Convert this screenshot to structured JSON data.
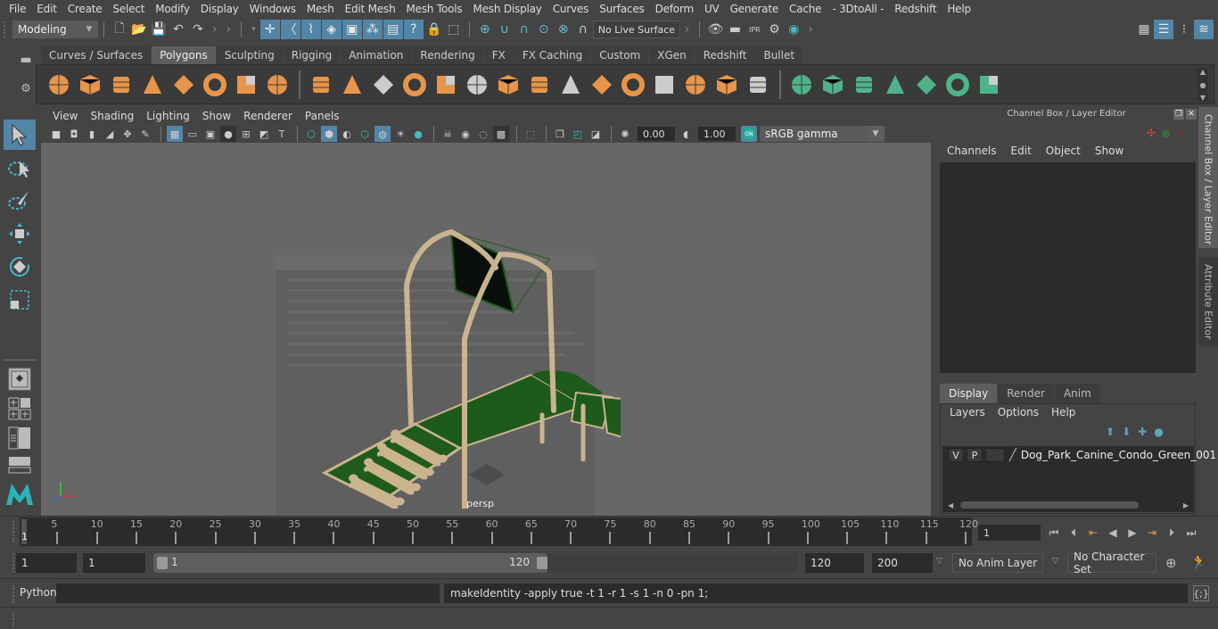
{
  "menubar": [
    "File",
    "Edit",
    "Create",
    "Select",
    "Modify",
    "Display",
    "Windows",
    "Mesh",
    "Edit Mesh",
    "Mesh Tools",
    "Mesh Display",
    "Curves",
    "Surfaces",
    "Deform",
    "UV",
    "Generate",
    "Cache",
    "- 3DtoAll -",
    "Redshift",
    "Help"
  ],
  "statusline": {
    "mode": "Modeling",
    "live_surface": "No Live Surface",
    "file_icons": [
      "new-scene-icon",
      "open-scene-icon",
      "save-scene-icon",
      "undo-icon",
      "redo-icon"
    ],
    "select_mode_icons": [
      "select-hierarchy-icon",
      "select-objects-icon",
      "select-components-icon",
      "select-by-component-type-icon",
      "select-surface-icon",
      "select-lattice-icon",
      "select-render-icon",
      "select-misc-icon"
    ],
    "snap_icons": [
      "snap-grid-icon",
      "snap-curve-icon",
      "snap-point-icon",
      "snap-view-plane-icon",
      "snap-live-icon",
      "snap-magnet-icon"
    ],
    "render_icons": [
      "render-view-icon",
      "render-frame-icon",
      "ipr-render-icon",
      "render-settings-icon",
      "hypershade-icon"
    ],
    "workspace_icons": [
      "modeling-toolkit-icon",
      "attribute-editor-icon",
      "tool-settings-icon",
      "channel-box-icon"
    ]
  },
  "shelf": {
    "tabs": [
      "Curves / Surfaces",
      "Polygons",
      "Sculpting",
      "Rigging",
      "Animation",
      "Rendering",
      "FX",
      "FX Caching",
      "Custom",
      "XGen",
      "Redshift",
      "Bullet"
    ],
    "active_tab": "Polygons",
    "items_orange": [
      "poly-sphere-icon",
      "poly-cube-icon",
      "poly-cylinder-icon",
      "poly-cone-icon",
      "poly-plane-icon",
      "poly-torus-icon",
      "poly-pyramid-icon",
      "poly-pipe-icon"
    ],
    "items_orange2": [
      "combine-icon",
      "separate-icon",
      "mirror-icon",
      "smooth-icon",
      "reduce-icon",
      "bevel-icon",
      "multicut-icon",
      "extrude-icon",
      "bridge-icon",
      "append-icon",
      "insert-edge-loop-icon",
      "offset-edge-loop-icon",
      "merge-icon",
      "target-weld-icon",
      "collapse-icon"
    ],
    "items_green": [
      "planar-uv-icon",
      "cylindrical-uv-icon",
      "spherical-uv-icon",
      "automatic-uv-icon",
      "unfold-uv-icon",
      "uv-editor-icon",
      "uv-layout-icon"
    ]
  },
  "tools": [
    "select-tool-icon",
    "lasso-tool-icon",
    "paint-select-tool-icon",
    "move-tool-icon",
    "rotate-tool-icon",
    "scale-tool-icon",
    "single-perspective-layout-icon",
    "four-view-layout-icon",
    "persp-outliner-layout-icon",
    "persp-graph-layout-icon",
    "maya-logo-icon"
  ],
  "panel": {
    "menu": [
      "View",
      "Shading",
      "Lighting",
      "Show",
      "Renderer",
      "Panels"
    ],
    "exposure": "0.00",
    "gamma": "1.00",
    "colorspace": "sRGB gamma",
    "camera_label": "persp"
  },
  "channel_box": {
    "title": "Channel Box / Layer Editor",
    "menu": [
      "Channels",
      "Edit",
      "Object",
      "Show"
    ]
  },
  "layer_editor": {
    "tabs": [
      "Display",
      "Render",
      "Anim"
    ],
    "active_tab": "Display",
    "menu": [
      "Layers",
      "Options",
      "Help"
    ],
    "layers": [
      {
        "v": "V",
        "p": "P",
        "name": "Dog_Park_Canine_Condo_Green_001"
      }
    ]
  },
  "side_tabs": [
    "Channel Box / Layer Editor",
    "Attribute Editor"
  ],
  "timeline": {
    "ticks": [
      5,
      10,
      15,
      20,
      25,
      30,
      35,
      40,
      45,
      50,
      55,
      60,
      65,
      70,
      75,
      80,
      85,
      90,
      95,
      100,
      105,
      110,
      115,
      120
    ],
    "min": 1,
    "max": 120,
    "current_frame": "1",
    "current_frame_field": "1"
  },
  "range": {
    "start": "1",
    "anim_start": "1",
    "range_start": "1",
    "range_end": "120",
    "end": "120",
    "anim_end": "200",
    "anim_layer": "No Anim Layer",
    "character_set": "No Character Set"
  },
  "command": {
    "language": "Python",
    "input": "",
    "result": "makeIdentity -apply true -t 1 -r 1 -s 1 -n 0 -pn 1;"
  },
  "colors": {
    "accent_blue": "#5285a6",
    "shelf_orange": "#e8954a",
    "shelf_green": "#4fb38a",
    "model_green": "#1f5c1c",
    "model_tan": "#c9b48e"
  }
}
